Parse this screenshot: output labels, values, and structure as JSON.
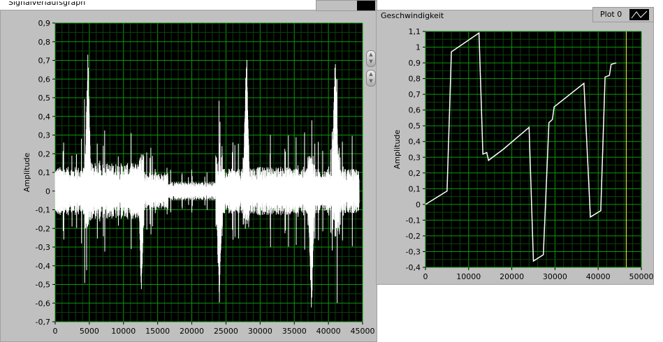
{
  "left_graph": {
    "title": "Signalverlaufsgraph"
  },
  "right_graph": {
    "title": "Geschwindigkeit",
    "legend": "Plot 0"
  },
  "chart_data": [
    {
      "type": "line",
      "title": "Signalverlaufsgraph",
      "xlabel": "",
      "ylabel": "Amplitude",
      "xlim": [
        0,
        45000
      ],
      "ylim": [
        -0.7,
        0.9
      ],
      "xticks": [
        "0",
        "5000",
        "10000",
        "15000",
        "20000",
        "25000",
        "30000",
        "35000",
        "40000",
        "45000"
      ],
      "yticks": [
        "0,9",
        "0,8",
        "0,7",
        "0,6",
        "0,5",
        "0,4",
        "0,3",
        "0,2",
        "0,1",
        "0",
        "-0,1",
        "-0,2",
        "-0,3",
        "-0,4",
        "-0,5",
        "-0,6",
        "-0,7"
      ],
      "grid": true,
      "series_color": "#ffffff",
      "segments": [
        {
          "x0": 0,
          "x1": 4300,
          "amp": 0.13
        },
        {
          "x0": 4300,
          "x1": 5200,
          "amp": 0.2,
          "peak": 0.8,
          "at": 4800
        },
        {
          "x0": 5200,
          "x1": 12200,
          "amp": 0.15
        },
        {
          "x0": 12200,
          "x1": 13000,
          "amp": 0.2,
          "peak": -0.6,
          "at": 12600
        },
        {
          "x0": 13000,
          "x1": 16500,
          "amp": 0.1
        },
        {
          "x0": 16500,
          "x1": 23500,
          "amp": 0.05
        },
        {
          "x0": 23500,
          "x1": 24500,
          "amp": 0.2,
          "peak": -0.63,
          "at": 24000
        },
        {
          "x0": 24500,
          "x1": 27500,
          "amp": 0.12
        },
        {
          "x0": 27500,
          "x1": 28500,
          "amp": 0.2,
          "peak": 0.8,
          "at": 28000
        },
        {
          "x0": 28500,
          "x1": 37000,
          "amp": 0.13
        },
        {
          "x0": 37000,
          "x1": 38000,
          "amp": 0.2,
          "peak": -0.7,
          "at": 37500
        },
        {
          "x0": 38000,
          "x1": 40500,
          "amp": 0.12
        },
        {
          "x0": 40500,
          "x1": 41600,
          "amp": 0.25,
          "peak": 0.75,
          "at": 41000
        },
        {
          "x0": 41600,
          "x1": 44500,
          "amp": 0.12
        }
      ]
    },
    {
      "type": "line",
      "title": "Geschwindigkeit",
      "xlabel": "",
      "ylabel": "Amplitude",
      "xlim": [
        0,
        50000
      ],
      "ylim": [
        -0.4,
        1.1
      ],
      "xticks": [
        "0",
        "10000",
        "20000",
        "30000",
        "40000",
        "50000"
      ],
      "yticks": [
        "1,1",
        "1",
        "0,9",
        "0,8",
        "0,7",
        "0,6",
        "0,5",
        "0,4",
        "0,3",
        "0,2",
        "0,1",
        "0",
        "-0,1",
        "-0,2",
        "-0,3",
        "-0,4"
      ],
      "grid": true,
      "cursor_x": 46500,
      "series": [
        {
          "name": "Plot 0",
          "x": [
            0,
            5000,
            6000,
            12400,
            13300,
            14200,
            14600,
            18000,
            24000,
            25000,
            27300,
            28600,
            29400,
            29800,
            36700,
            38200,
            40600,
            41600,
            42600,
            43000,
            44200
          ],
          "y": [
            0,
            0.085,
            0.97,
            1.09,
            0.32,
            0.33,
            0.28,
            0.35,
            0.49,
            -0.36,
            -0.32,
            0.52,
            0.54,
            0.62,
            0.77,
            -0.08,
            -0.04,
            0.81,
            0.82,
            0.89,
            0.9
          ]
        }
      ]
    }
  ]
}
